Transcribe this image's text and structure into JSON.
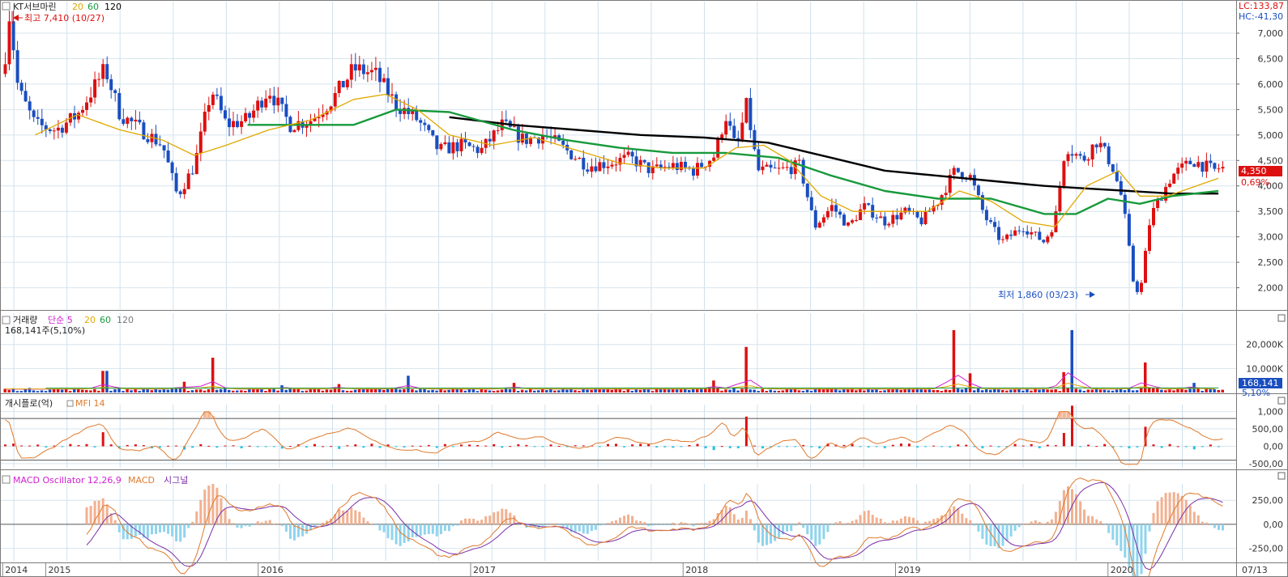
{
  "app": {
    "ticker_name": "KT서브마린",
    "ma_periods": [
      "20",
      "60",
      "120"
    ],
    "ma_colors": {
      "ma5": "#d21ed2",
      "ma20": "#e0a800",
      "ma60": "#189a3c",
      "ma120": "#000000"
    },
    "lc_text": "LC:133,87",
    "hc_text": "HC:-41,30",
    "high_marker": "최고 7,410 (10/27)",
    "low_marker": "최저 1,860 (03/23)",
    "last_price": "4,350",
    "last_change": "0,69%",
    "up_color": "#dd1010",
    "down_color": "#1a4ec0"
  },
  "volume_panel": {
    "title": "거래량",
    "ma_label": "단순 5",
    "ma_periods": [
      "20",
      "60",
      "120"
    ],
    "current": "168,141주(5,10%)",
    "last_value": "168,141",
    "last_pct": "5,10%",
    "axis_ticks": [
      "20,000K",
      "10,000K"
    ]
  },
  "flow_panel": {
    "title": "개시플로(억)",
    "mfi_label": "MFI 14",
    "axis_ticks": [
      "1,000",
      "500,00",
      "0,00",
      "-500,00"
    ],
    "pos_color": "#dd1010",
    "neg_color": "#22c0e0",
    "mfi_color": "#e07a2c"
  },
  "macd_panel": {
    "title": "MACD Oscillator 12,26,9",
    "macd_label": "MACD",
    "signal_label": "시그널",
    "axis_ticks": [
      "250,00",
      "0,00",
      "-250,00"
    ],
    "pos_color": "#f2b090",
    "neg_color": "#8fd4ee",
    "macd_color": "#e07a2c",
    "signal_color": "#7a2fa8"
  },
  "x_axis": {
    "labels": [
      "2014",
      "2015",
      "2016",
      "2017",
      "2018",
      "2019",
      "2020",
      "07/13"
    ]
  },
  "chart_data": {
    "type": "candlestick",
    "price_axis": {
      "ticks": [
        7000,
        6500,
        6000,
        5500,
        5000,
        4500,
        4000,
        3500,
        3000,
        2500,
        2000
      ],
      "ylim": [
        1580,
        7620
      ]
    },
    "x_range": [
      2014.8,
      2020.55
    ],
    "price_path": [
      [
        2014.8,
        6200
      ],
      [
        2014.83,
        7410
      ],
      [
        2014.87,
        5900
      ],
      [
        2014.95,
        5200
      ],
      [
        2015.05,
        5100
      ],
      [
        2015.15,
        5400
      ],
      [
        2015.28,
        6300
      ],
      [
        2015.35,
        5400
      ],
      [
        2015.45,
        5100
      ],
      [
        2015.55,
        4800
      ],
      [
        2015.62,
        3800
      ],
      [
        2015.7,
        4400
      ],
      [
        2015.78,
        5900
      ],
      [
        2015.85,
        5200
      ],
      [
        2015.95,
        5300
      ],
      [
        2016.05,
        5900
      ],
      [
        2016.15,
        5200
      ],
      [
        2016.25,
        5300
      ],
      [
        2016.35,
        5700
      ],
      [
        2016.45,
        6300
      ],
      [
        2016.55,
        6200
      ],
      [
        2016.65,
        5600
      ],
      [
        2016.75,
        5300
      ],
      [
        2016.85,
        4700
      ],
      [
        2016.95,
        4800
      ],
      [
        2017.05,
        4700
      ],
      [
        2017.15,
        5200
      ],
      [
        2017.25,
        4900
      ],
      [
        2017.35,
        5000
      ],
      [
        2017.45,
        4700
      ],
      [
        2017.55,
        4400
      ],
      [
        2017.65,
        4450
      ],
      [
        2017.75,
        4550
      ],
      [
        2017.85,
        4300
      ],
      [
        2017.95,
        4400
      ],
      [
        2018.05,
        4300
      ],
      [
        2018.15,
        4600
      ],
      [
        2018.2,
        5400
      ],
      [
        2018.25,
        4700
      ],
      [
        2018.3,
        5600
      ],
      [
        2018.35,
        4300
      ],
      [
        2018.45,
        4300
      ],
      [
        2018.55,
        4400
      ],
      [
        2018.62,
        3200
      ],
      [
        2018.7,
        3600
      ],
      [
        2018.78,
        3200
      ],
      [
        2018.85,
        3600
      ],
      [
        2018.95,
        3300
      ],
      [
        2019.05,
        3500
      ],
      [
        2019.12,
        3300
      ],
      [
        2019.2,
        3700
      ],
      [
        2019.28,
        4300
      ],
      [
        2019.35,
        4200
      ],
      [
        2019.42,
        3400
      ],
      [
        2019.5,
        2900
      ],
      [
        2019.6,
        3200
      ],
      [
        2019.7,
        2900
      ],
      [
        2019.75,
        3300
      ],
      [
        2019.8,
        4800
      ],
      [
        2019.88,
        4500
      ],
      [
        2019.95,
        4900
      ],
      [
        2020.02,
        4400
      ],
      [
        2020.07,
        3700
      ],
      [
        2020.12,
        2100
      ],
      [
        2020.15,
        1860
      ],
      [
        2020.2,
        3400
      ],
      [
        2020.3,
        4200
      ],
      [
        2020.4,
        4500
      ],
      [
        2020.5,
        4300
      ],
      [
        2020.52,
        4350
      ]
    ],
    "ma20_path": [
      [
        2014.95,
        5000
      ],
      [
        2015.15,
        5400
      ],
      [
        2015.35,
        5100
      ],
      [
        2015.55,
        4900
      ],
      [
        2015.7,
        4600
      ],
      [
        2015.85,
        4800
      ],
      [
        2016.05,
        5100
      ],
      [
        2016.25,
        5300
      ],
      [
        2016.45,
        5700
      ],
      [
        2016.6,
        5800
      ],
      [
        2016.75,
        5500
      ],
      [
        2016.9,
        5000
      ],
      [
        2017.1,
        4800
      ],
      [
        2017.3,
        4950
      ],
      [
        2017.5,
        4700
      ],
      [
        2017.7,
        4450
      ],
      [
        2017.9,
        4350
      ],
      [
        2018.1,
        4350
      ],
      [
        2018.25,
        4750
      ],
      [
        2018.38,
        4800
      ],
      [
        2018.5,
        4500
      ],
      [
        2018.65,
        3800
      ],
      [
        2018.8,
        3500
      ],
      [
        2018.95,
        3500
      ],
      [
        2019.15,
        3500
      ],
      [
        2019.3,
        3900
      ],
      [
        2019.45,
        3700
      ],
      [
        2019.6,
        3300
      ],
      [
        2019.75,
        3200
      ],
      [
        2019.9,
        4000
      ],
      [
        2020.05,
        4300
      ],
      [
        2020.15,
        3800
      ],
      [
        2020.28,
        3800
      ],
      [
        2020.52,
        4150
      ]
    ],
    "ma60_path": [
      [
        2015.95,
        5200
      ],
      [
        2016.2,
        5200
      ],
      [
        2016.45,
        5200
      ],
      [
        2016.65,
        5500
      ],
      [
        2016.9,
        5450
      ],
      [
        2017.2,
        5100
      ],
      [
        2017.45,
        4900
      ],
      [
        2017.7,
        4750
      ],
      [
        2017.95,
        4650
      ],
      [
        2018.2,
        4650
      ],
      [
        2018.45,
        4550
      ],
      [
        2018.7,
        4200
      ],
      [
        2018.95,
        3900
      ],
      [
        2019.2,
        3750
      ],
      [
        2019.45,
        3750
      ],
      [
        2019.7,
        3450
      ],
      [
        2019.85,
        3450
      ],
      [
        2020.0,
        3750
      ],
      [
        2020.15,
        3650
      ],
      [
        2020.3,
        3800
      ],
      [
        2020.52,
        3900
      ]
    ],
    "ma120_path": [
      [
        2016.9,
        5350
      ],
      [
        2017.2,
        5200
      ],
      [
        2017.5,
        5100
      ],
      [
        2017.8,
        5000
      ],
      [
        2018.1,
        4950
      ],
      [
        2018.4,
        4850
      ],
      [
        2018.7,
        4550
      ],
      [
        2018.95,
        4300
      ],
      [
        2019.2,
        4200
      ],
      [
        2019.45,
        4100
      ],
      [
        2019.7,
        4000
      ],
      [
        2019.9,
        3950
      ],
      [
        2020.1,
        3900
      ],
      [
        2020.3,
        3850
      ],
      [
        2020.52,
        3850
      ]
    ],
    "volume_spikes": [
      [
        2015.28,
        9000
      ],
      [
        2015.65,
        4500
      ],
      [
        2015.78,
        14500
      ],
      [
        2016.12,
        3000
      ],
      [
        2016.38,
        3500
      ],
      [
        2016.7,
        7000
      ],
      [
        2017.2,
        4000
      ],
      [
        2018.15,
        5000
      ],
      [
        2018.3,
        19000
      ],
      [
        2019.28,
        26000
      ],
      [
        2019.35,
        8000
      ],
      [
        2019.8,
        8500
      ],
      [
        2019.83,
        26000
      ],
      [
        2020.17,
        12500
      ],
      [
        2020.4,
        4000
      ]
    ]
  }
}
